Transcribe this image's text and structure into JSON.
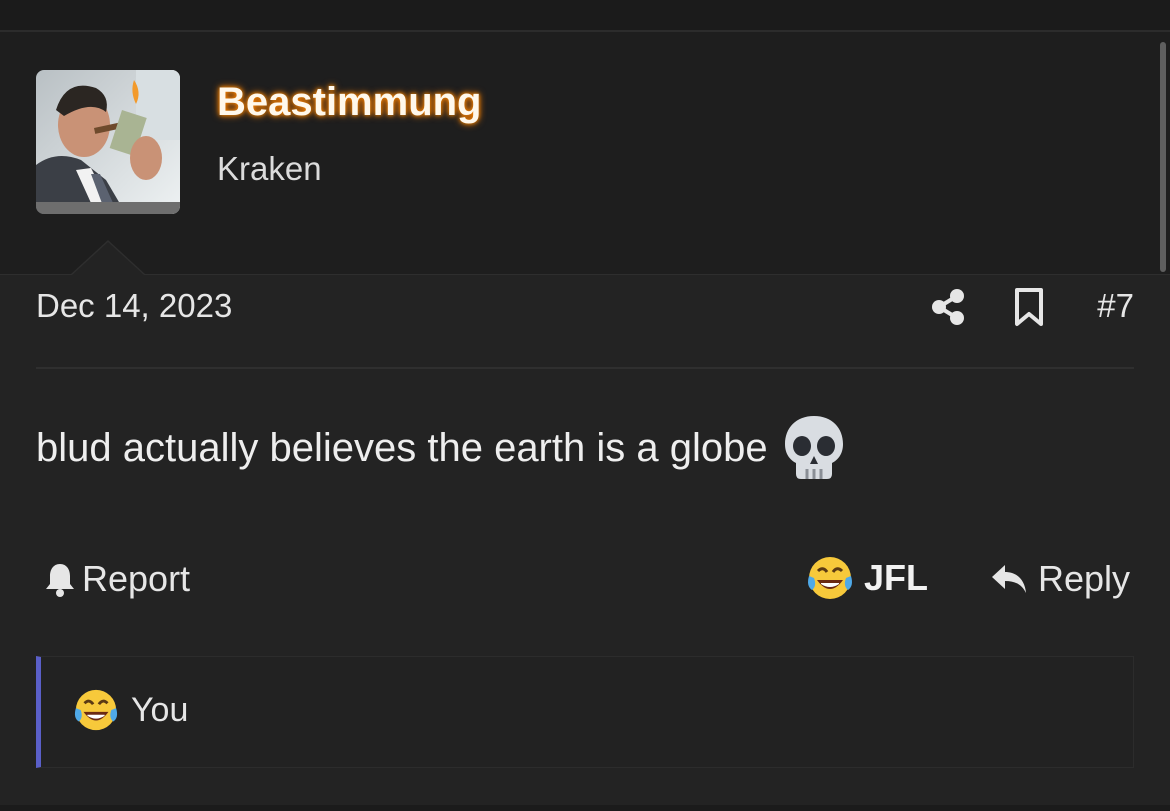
{
  "post": {
    "username": "Beastimmung",
    "user_title": "Kraken",
    "date": "Dec 14, 2023",
    "post_number": "#7",
    "message": "blud actually believes the earth is a globe",
    "message_emoji": "skull-emoji"
  },
  "actions": {
    "report_label": "Report",
    "reaction_label": "JFL",
    "reply_label": "Reply"
  },
  "reactions": {
    "summary_label": "You"
  },
  "colors": {
    "background": "#232323",
    "username_glow": "#ff7b00",
    "reaction_bar_accent": "#5a5fc8"
  }
}
